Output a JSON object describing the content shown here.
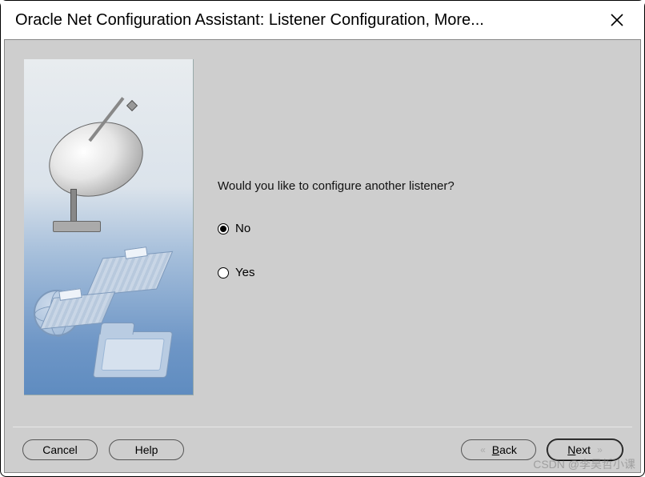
{
  "title": "Oracle Net Configuration Assistant: Listener Configuration, More...",
  "question": "Would you like to configure another listener?",
  "options": {
    "no": {
      "label": "No",
      "selected": true
    },
    "yes": {
      "label": "Yes",
      "selected": false
    }
  },
  "buttons": {
    "cancel": "Cancel",
    "help": "Help",
    "back": "Back",
    "next": "Next"
  },
  "watermark": "CSDN @李昊哲小课"
}
